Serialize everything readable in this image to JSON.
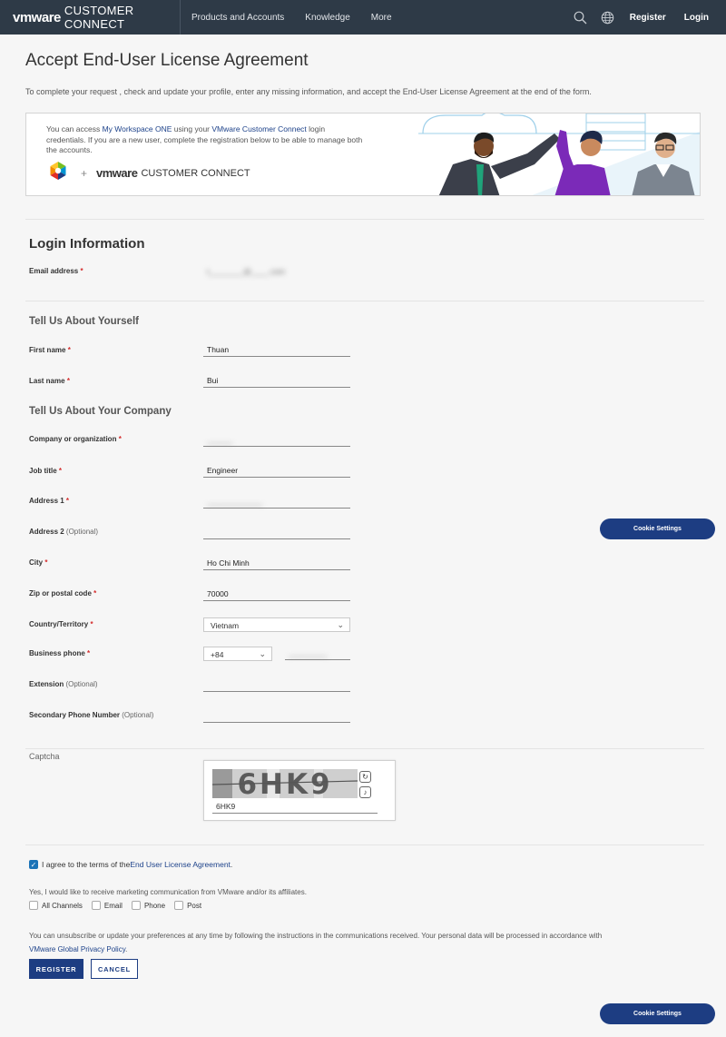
{
  "header": {
    "brand": "vmware",
    "product": "CUSTOMER CONNECT",
    "nav": [
      "Products and Accounts",
      "Knowledge",
      "More"
    ],
    "register": "Register",
    "login": "Login"
  },
  "page": {
    "title": "Accept End-User License Agreement",
    "intro": "To complete your request , check and update your profile, enter any missing information, and accept the End-User License Agreement at the end of the form."
  },
  "banner": {
    "text_1": "You can access ",
    "link_1": "My Workspace ONE",
    "text_2": " using your ",
    "link_2": "VMware Customer Connect",
    "text_3": " login credentials. If you are a new user, complete the registration below to be able to manage both the accounts.",
    "plus": "+",
    "brand": "vmware",
    "product": "CUSTOMER CONNECT"
  },
  "login_info": {
    "heading": "Login Information",
    "email_label": "Email address",
    "email_value": "t________@____.com"
  },
  "about_you": {
    "heading": "Tell Us About Yourself",
    "first_name_label": "First name",
    "first_name_value": "Thuan",
    "last_name_label": "Last name",
    "last_name_value": "Bui"
  },
  "company": {
    "heading": "Tell Us About Your Company",
    "company_label": "Company or organization",
    "company_value": "______",
    "job_label": "Job title",
    "job_value": "Engineer",
    "address1_label": "Address 1",
    "address1_value": "_____________",
    "address2_label": "Address 2",
    "address2_value": "",
    "city_label": "City",
    "city_value": "Ho Chi Minh",
    "zip_label": "Zip or postal code",
    "zip_value": "70000",
    "country_label": "Country/Territory",
    "country_value": "Vietnam",
    "phone_label": "Business phone",
    "phone_code": "+84",
    "phone_value": "_________",
    "extension_label": "Extension",
    "extension_value": "",
    "secondary_label": "Secondary Phone Number",
    "secondary_value": "",
    "optional": "(Optional)",
    "required_mark": "*"
  },
  "captcha": {
    "label": "Captcha",
    "image_text": "6HK9",
    "input_value": "6HK9"
  },
  "agreement": {
    "text": "I agree to the terms of the ",
    "link": "End User License Agreement",
    "suffix": " .",
    "checked": true
  },
  "marketing": {
    "text": "Yes, I would like to receive marketing communication from VMware and/or its affiliates.",
    "channels": [
      "All Channels",
      "Email",
      "Phone",
      "Post"
    ]
  },
  "unsubscribe": {
    "text": "You can unsubscribe or update your preferences at any time by following the instructions in the communications received. Your personal data will be processed in accordance with ",
    "link": "VMware Global Privacy Policy",
    "suffix": "."
  },
  "buttons": {
    "register": "REGISTER",
    "cancel": "CANCEL"
  },
  "cookie": {
    "label": "Cookie Settings"
  },
  "colors": {
    "header_bg": "#2e3a47",
    "primary": "#1d3d82",
    "link": "#1d428a",
    "checkbox": "#1b73b7",
    "required": "#d42c2c"
  }
}
